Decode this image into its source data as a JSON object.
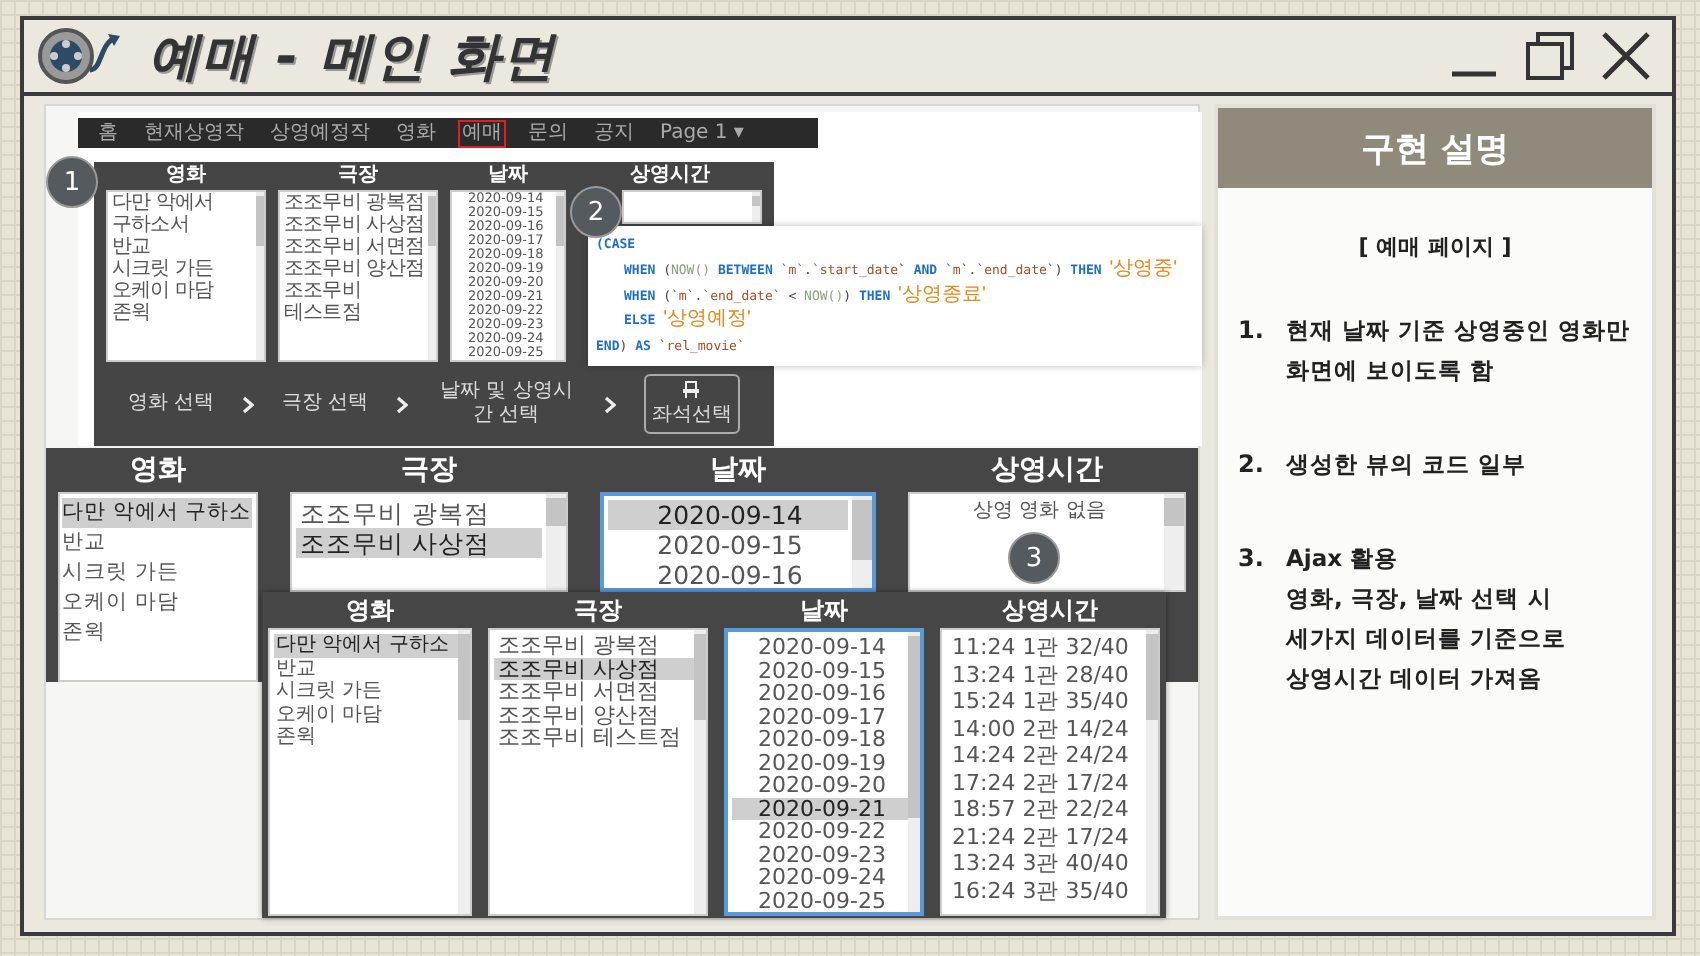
{
  "window": {
    "title": "예매 - 메인 화면"
  },
  "shots": [
    {
      "kind": "main",
      "nav": [
        {
          "label": "홈",
          "selected": false
        },
        {
          "label": "현재상영작",
          "selected": false
        },
        {
          "label": "상영예정작",
          "selected": false
        },
        {
          "label": "영화",
          "selected": false
        },
        {
          "label": "예매",
          "selected": true
        },
        {
          "label": "문의",
          "selected": false
        },
        {
          "label": "공지",
          "selected": false
        },
        {
          "label": "Page 1 ▾",
          "selected": false
        }
      ],
      "columns": [
        {
          "heading": "영화",
          "focused": false,
          "items": [
            {
              "text": "다만 악에서 구하소서",
              "selected": false
            },
            {
              "text": "반교",
              "selected": false
            },
            {
              "text": "시크릿 가든",
              "selected": false
            },
            {
              "text": "오케이 마담",
              "selected": false
            },
            {
              "text": "존윅",
              "selected": false
            }
          ]
        },
        {
          "heading": "극장",
          "focused": false,
          "items": [
            {
              "text": "조조무비 광복점",
              "selected": false
            },
            {
              "text": "조조무비 사상점",
              "selected": false
            },
            {
              "text": "조조무비 서면점",
              "selected": false
            },
            {
              "text": "조조무비 양산점",
              "selected": false
            },
            {
              "text": "조조무비 테스트점",
              "selected": false
            }
          ]
        },
        {
          "heading": "날짜",
          "focused": false,
          "items": [
            {
              "text": "2020-09-14",
              "selected": false
            },
            {
              "text": "2020-09-15",
              "selected": false
            },
            {
              "text": "2020-09-16",
              "selected": false
            },
            {
              "text": "2020-09-17",
              "selected": false
            },
            {
              "text": "2020-09-18",
              "selected": false
            },
            {
              "text": "2020-09-19",
              "selected": false
            },
            {
              "text": "2020-09-20",
              "selected": false
            },
            {
              "text": "2020-09-21",
              "selected": false
            },
            {
              "text": "2020-09-22",
              "selected": false
            },
            {
              "text": "2020-09-23",
              "selected": false
            },
            {
              "text": "2020-09-24",
              "selected": false
            },
            {
              "text": "2020-09-25",
              "selected": false
            }
          ]
        },
        {
          "heading": "상영시간",
          "focused": false
        }
      ],
      "steps": [
        "영화 선택",
        "극장 선택",
        "날짜 및 상영시간 선택"
      ],
      "seat_button": "좌석선택"
    },
    {
      "kind": "large",
      "columns": [
        {
          "heading": "영화",
          "focused": false,
          "items": [
            {
              "text": "다만 악에서 구하소",
              "selected": true
            },
            {
              "text": "반교",
              "selected": false
            },
            {
              "text": "시크릿 가든",
              "selected": false
            },
            {
              "text": "오케이 마담",
              "selected": false
            },
            {
              "text": "존윅",
              "selected": false
            }
          ]
        },
        {
          "heading": "극장",
          "focused": false,
          "items": [
            {
              "text": "조조무비 광복점",
              "selected": false
            },
            {
              "text": "조조무비 사상점",
              "selected": true
            }
          ]
        },
        {
          "heading": "날짜",
          "focused": true,
          "items": [
            {
              "text": "2020-09-14",
              "selected": true
            },
            {
              "text": "2020-09-15",
              "selected": false
            },
            {
              "text": "2020-09-16",
              "selected": false
            }
          ]
        },
        {
          "heading": "상영시간",
          "focused": false,
          "message": "상영 영화 없음"
        }
      ]
    },
    {
      "kind": "compact",
      "columns": [
        {
          "heading": "영화",
          "focused": false,
          "items": [
            {
              "text": "다만 악에서 구하소",
              "selected": true
            },
            {
              "text": "반교",
              "selected": false
            },
            {
              "text": "시크릿 가든",
              "selected": false
            },
            {
              "text": "오케이 마담",
              "selected": false
            },
            {
              "text": "존윅",
              "selected": false
            }
          ]
        },
        {
          "heading": "극장",
          "focused": false,
          "items": [
            {
              "text": "조조무비 광복점",
              "selected": false
            },
            {
              "text": "조조무비 사상점",
              "selected": true
            },
            {
              "text": "조조무비 서면점",
              "selected": false
            },
            {
              "text": "조조무비 양산점",
              "selected": false
            },
            {
              "text": "조조무비 테스트점",
              "selected": false
            }
          ]
        },
        {
          "heading": "날짜",
          "focused": true,
          "items": [
            {
              "text": "2020-09-14",
              "selected": false
            },
            {
              "text": "2020-09-15",
              "selected": false
            },
            {
              "text": "2020-09-16",
              "selected": false
            },
            {
              "text": "2020-09-17",
              "selected": false
            },
            {
              "text": "2020-09-18",
              "selected": false
            },
            {
              "text": "2020-09-19",
              "selected": false
            },
            {
              "text": "2020-09-20",
              "selected": false
            },
            {
              "text": "2020-09-21",
              "selected": true
            },
            {
              "text": "2020-09-22",
              "selected": false
            },
            {
              "text": "2020-09-23",
              "selected": false
            },
            {
              "text": "2020-09-24",
              "selected": false
            },
            {
              "text": "2020-09-25",
              "selected": false
            }
          ]
        },
        {
          "heading": "상영시간",
          "focused": false,
          "items": [
            {
              "text": "11:24 1관 32/40",
              "selected": false
            },
            {
              "text": "13:24 1관 28/40",
              "selected": false
            },
            {
              "text": "15:24 1관 35/40",
              "selected": false
            },
            {
              "text": "14:00 2관 14/24",
              "selected": false
            },
            {
              "text": "14:24 2관 24/24",
              "selected": false
            },
            {
              "text": "17:24 2관 17/24",
              "selected": false
            },
            {
              "text": "18:57 2관 22/24",
              "selected": false
            },
            {
              "text": "21:24 2관 17/24",
              "selected": false
            },
            {
              "text": "13:24 3관 40/40",
              "selected": false
            },
            {
              "text": "16:24 3관 35/40",
              "selected": false
            }
          ]
        }
      ]
    }
  ],
  "code": {
    "lines": [
      {
        "indent": false,
        "tokens": [
          {
            "text": "(CASE",
            "kind": "kw"
          }
        ]
      },
      {
        "indent": true,
        "tokens": [
          {
            "text": "WHEN",
            "kind": "kw"
          },
          {
            "text": " (",
            "kind": "plain"
          },
          {
            "text": "NOW()",
            "kind": "fn"
          },
          {
            "text": " BETWEEN ",
            "kind": "kw"
          },
          {
            "text": "`m`",
            "kind": "id"
          },
          {
            "text": ".",
            "kind": "plain"
          },
          {
            "text": "`start_date`",
            "kind": "id"
          },
          {
            "text": " AND ",
            "kind": "kw"
          },
          {
            "text": "`m`",
            "kind": "id"
          },
          {
            "text": ".",
            "kind": "plain"
          },
          {
            "text": "`end_date`",
            "kind": "id"
          },
          {
            "text": ")",
            "kind": "plain"
          },
          {
            "text": " THEN ",
            "kind": "kw"
          },
          {
            "text": "'상영중'",
            "kind": "str"
          }
        ]
      },
      {
        "indent": true,
        "tokens": [
          {
            "text": "WHEN",
            "kind": "kw"
          },
          {
            "text": " (",
            "kind": "plain"
          },
          {
            "text": "`m`",
            "kind": "id"
          },
          {
            "text": ".",
            "kind": "plain"
          },
          {
            "text": "`end_date`",
            "kind": "id"
          },
          {
            "text": " < ",
            "kind": "plain"
          },
          {
            "text": "NOW()",
            "kind": "fn"
          },
          {
            "text": ")",
            "kind": "plain"
          },
          {
            "text": " THEN ",
            "kind": "kw"
          },
          {
            "text": "'상영종료'",
            "kind": "str"
          }
        ]
      },
      {
        "indent": true,
        "tokens": [
          {
            "text": "ELSE ",
            "kind": "kw"
          },
          {
            "text": "'상영예정'",
            "kind": "str"
          }
        ]
      },
      {
        "indent": false,
        "tokens": [
          {
            "text": "END",
            "kind": "kw"
          },
          {
            "text": ") ",
            "kind": "plain"
          },
          {
            "text": "AS ",
            "kind": "kw"
          },
          {
            "text": "`rel_movie`",
            "kind": "id"
          }
        ]
      }
    ]
  },
  "badges": [
    "1",
    "2",
    "3"
  ],
  "explanation": {
    "title": "구현 설명",
    "subtitle": "[ 예매 페이지 ]",
    "items": [
      {
        "number": "1.",
        "lines": [
          "현재 날짜 기준 상영중인 영화만",
          "화면에 보이도록 함"
        ]
      },
      {
        "number": "2.",
        "lines": [
          "생성한 뷰의 코드 일부"
        ]
      },
      {
        "number": "3.",
        "lines": [
          "Ajax 활용",
          "영화, 극장, 날짜 선택 시",
          "세가지 데이터를 기준으로",
          "상영시간 데이터 가져옴"
        ]
      }
    ]
  }
}
